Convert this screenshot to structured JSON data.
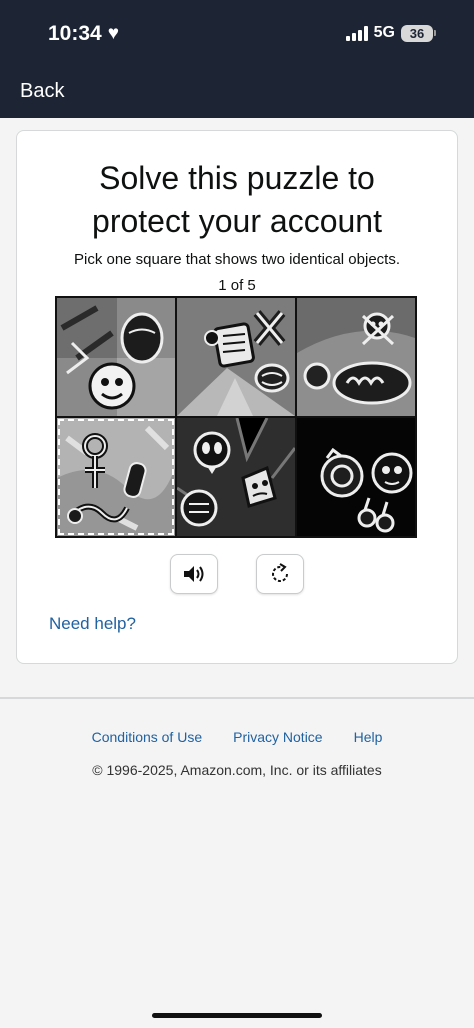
{
  "status_bar": {
    "time": "10:34",
    "network": "5G",
    "battery": "36"
  },
  "nav": {
    "back_label": "Back"
  },
  "puzzle": {
    "title_line1": "Solve this puzzle to",
    "title_line2": "protect your account",
    "instruction": "Pick one square that shows two identical objects.",
    "progress": "1 of 5",
    "tiles": [
      {
        "index": 1,
        "selected": false
      },
      {
        "index": 2,
        "selected": false
      },
      {
        "index": 3,
        "selected": false
      },
      {
        "index": 4,
        "selected": true
      },
      {
        "index": 5,
        "selected": false
      },
      {
        "index": 6,
        "selected": false
      }
    ],
    "audio_icon": "speaker-icon",
    "reload_icon": "reload-icon",
    "help_label": "Need help?"
  },
  "footer": {
    "links": [
      "Conditions of Use",
      "Privacy Notice",
      "Help"
    ],
    "copyright": "© 1996-2025, Amazon.com, Inc. or its affiliates"
  },
  "colors": {
    "header_bg": "#1d2433",
    "link": "#2162a1",
    "page_bg": "#f4f4f4"
  }
}
